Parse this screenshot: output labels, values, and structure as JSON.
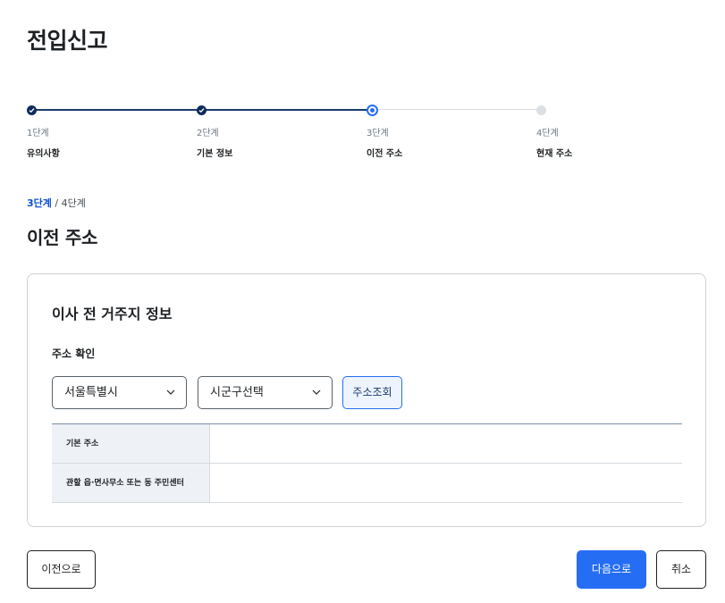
{
  "page": {
    "title": "전입신고"
  },
  "stepper": {
    "steps": [
      {
        "num": "1단계",
        "label": "유의사항",
        "state": "done"
      },
      {
        "num": "2단계",
        "label": "기본 정보",
        "state": "done"
      },
      {
        "num": "3단계",
        "label": "이전 주소",
        "state": "current"
      },
      {
        "num": "4단계",
        "label": "현재 주소",
        "state": "todo"
      }
    ]
  },
  "stage": {
    "current": "3단계",
    "separator": " / ",
    "total": "4단계"
  },
  "section": {
    "title": "이전 주소"
  },
  "card": {
    "title": "이사 전 거주지 정보",
    "field_label": "주소 확인",
    "city_select": {
      "value": "서울특별시"
    },
    "district_select": {
      "value": "시군구선택"
    },
    "lookup_button": "주소조회",
    "table": [
      {
        "header": "기본 주소",
        "value": ""
      },
      {
        "header": "관할 읍·면사무소 또는 동 주민센터",
        "value": ""
      }
    ]
  },
  "footer": {
    "prev_label": "이전으로",
    "next_label": "다음으로",
    "cancel_label": "취소"
  },
  "colors": {
    "accent": "#256ef4",
    "done_step": "#0f2b5b",
    "stage_highlight": "#0b50d0"
  }
}
